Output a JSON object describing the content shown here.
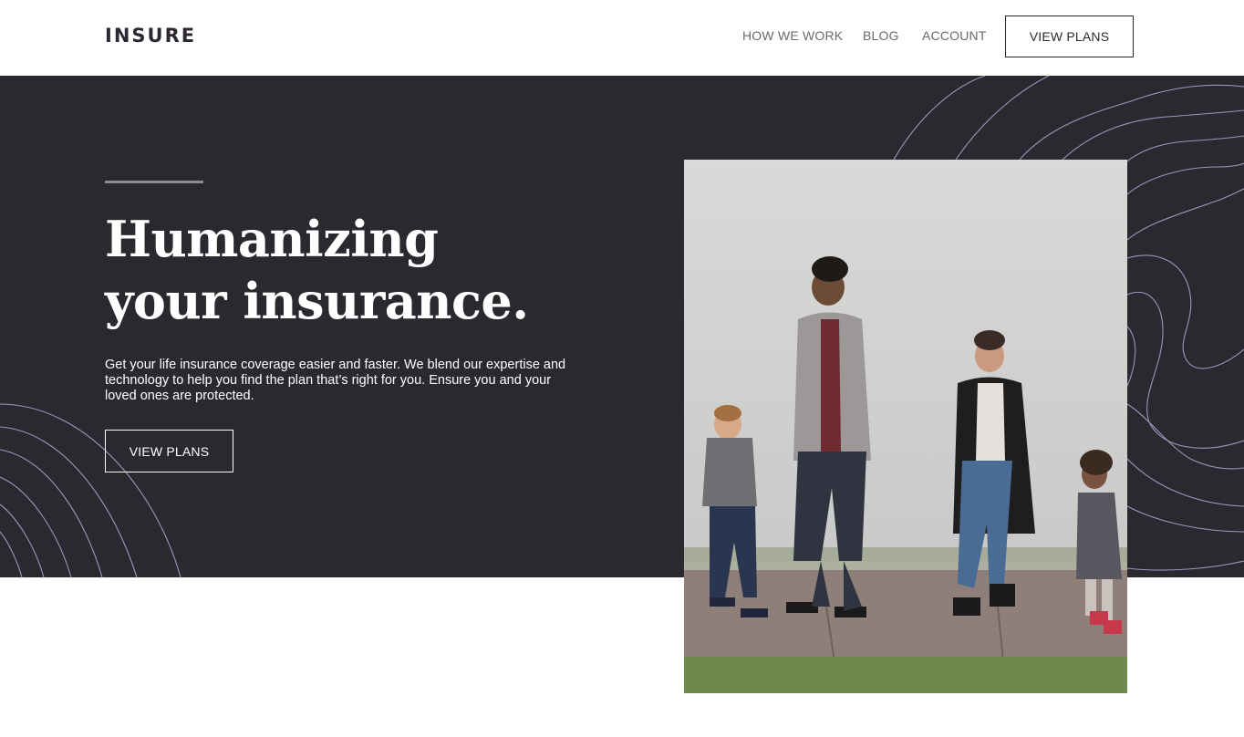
{
  "header": {
    "logo": "INSURE",
    "nav": {
      "how_we_work": "HOW WE WORK",
      "blog": "BLOG",
      "account": "ACCOUNT"
    },
    "cta_label": "VIEW PLANS"
  },
  "hero": {
    "headline_line1": "Humanizing",
    "headline_line2": "your insurance.",
    "description": "Get your life insurance coverage easier and faster. We blend our expertise and technology to help you find the plan that’s right for you. Ensure you and your loved ones are protected.",
    "cta_label": "VIEW PLANS",
    "image_subject": "family-walking-photo"
  },
  "colors": {
    "dark_violet": "#2c2830",
    "pattern_line": "#a7a3c9",
    "white": "#ffffff",
    "nav_text": "#6b6870"
  }
}
